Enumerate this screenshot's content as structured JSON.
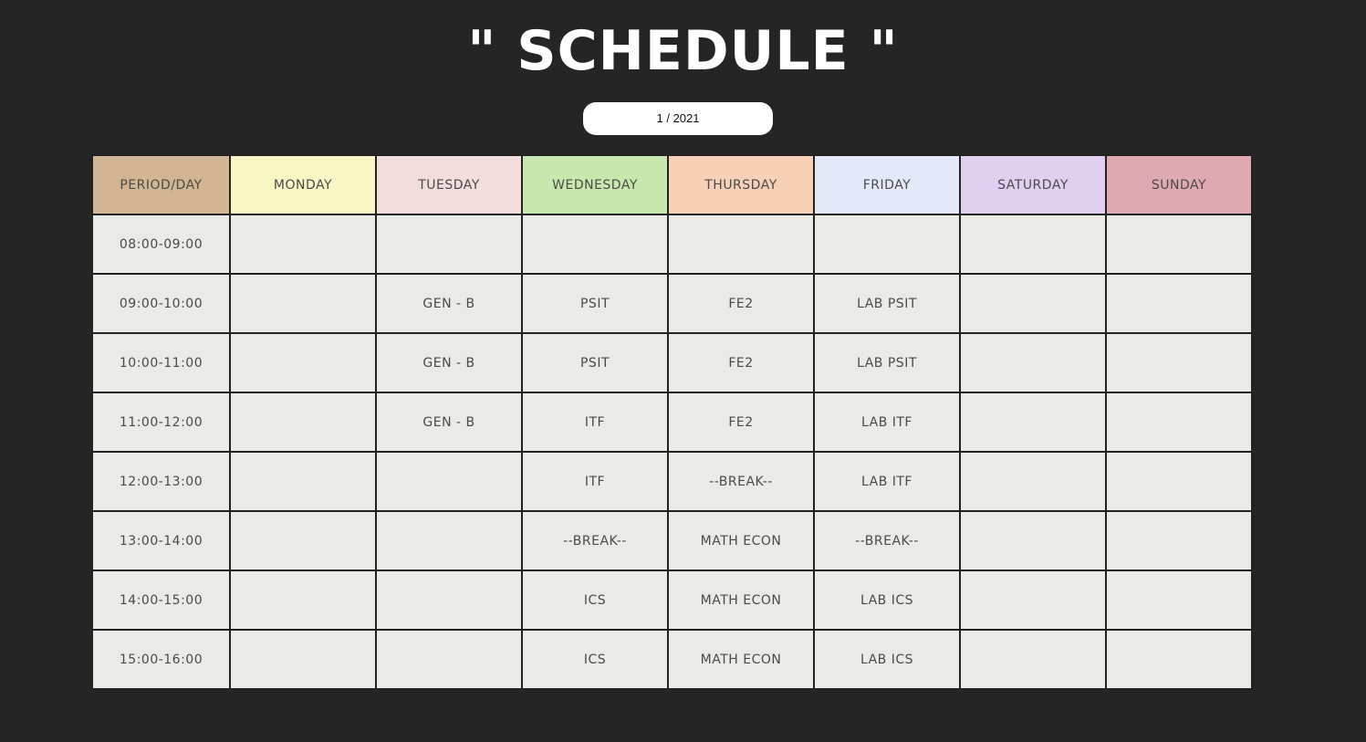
{
  "title": "\" SCHEDULE \"",
  "period_label": "1 / 2021",
  "header": {
    "period_day": "PERIOD/DAY",
    "days": [
      "MONDAY",
      "TUESDAY",
      "WEDNESDAY",
      "THURSDAY",
      "FRIDAY",
      "SATURDAY",
      "SUNDAY"
    ]
  },
  "colors": {
    "background": "#252525",
    "period_day": "#d2b693",
    "monday": "#f9f6c5",
    "tuesday": "#f3dcdc",
    "wednesday": "#c6e8ae",
    "thursday": "#f7d1b7",
    "friday": "#e3e9f8",
    "saturday": "#e1cff1",
    "sunday": "#dfa9b2",
    "cell": "#eaeae6"
  },
  "rows": [
    {
      "time": "08:00-09:00",
      "cells": [
        "",
        "",
        "",
        "",
        "",
        "",
        ""
      ]
    },
    {
      "time": "09:00-10:00",
      "cells": [
        "",
        "GEN - B",
        "PSIT",
        "FE2",
        "LAB PSIT",
        "",
        ""
      ]
    },
    {
      "time": "10:00-11:00",
      "cells": [
        "",
        "GEN - B",
        "PSIT",
        "FE2",
        "LAB PSIT",
        "",
        ""
      ]
    },
    {
      "time": "11:00-12:00",
      "cells": [
        "",
        "GEN - B",
        "ITF",
        "FE2",
        "LAB ITF",
        "",
        ""
      ]
    },
    {
      "time": "12:00-13:00",
      "cells": [
        "",
        "",
        "ITF",
        "--BREAK--",
        "LAB ITF",
        "",
        ""
      ]
    },
    {
      "time": "13:00-14:00",
      "cells": [
        "",
        "",
        "--BREAK--",
        "MATH ECON",
        "--BREAK--",
        "",
        ""
      ]
    },
    {
      "time": "14:00-15:00",
      "cells": [
        "",
        "",
        "ICS",
        "MATH ECON",
        "LAB ICS",
        "",
        ""
      ]
    },
    {
      "time": "15:00-16:00",
      "cells": [
        "",
        "",
        "ICS",
        "MATH ECON",
        "LAB ICS",
        "",
        ""
      ]
    }
  ]
}
